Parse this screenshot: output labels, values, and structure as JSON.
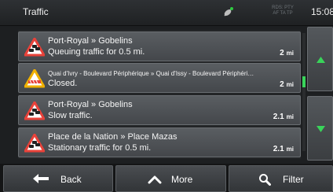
{
  "header": {
    "title": "Traffic",
    "gps_icon": "satellite-dish-icon",
    "rds_line1": "RDS: PTY",
    "rds_line2": "AF TA TP",
    "clock": "15:08"
  },
  "traffic_events": [
    {
      "route": "Port-Royal » Gobelins",
      "status": "Queuing traffic for 0.5 mi.",
      "distance": "2",
      "unit": "mi",
      "icon": "traffic-jam-warning-icon",
      "icon_color": "#e8423a"
    },
    {
      "route": "Quai d'Ivry - Boulevard Périphérique » Quai d'Issy - Boulevard Périphéri…",
      "status": "Closed.",
      "distance": "2",
      "unit": "mi",
      "icon": "road-works-warning-icon",
      "icon_color": "#f0b000"
    },
    {
      "route": "Port-Royal » Gobelins",
      "status": "Slow traffic.",
      "distance": "2.1",
      "unit": "mi",
      "icon": "traffic-jam-warning-icon",
      "icon_color": "#e8423a"
    },
    {
      "route": "Place de la Nation » Place Mazas",
      "status": "Stationary traffic for 0.5 mi.",
      "distance": "2.1",
      "unit": "mi",
      "icon": "traffic-jam-warning-icon",
      "icon_color": "#e8423a"
    }
  ],
  "side_buttons": {
    "up_icon": "scroll-up-arrow-icon",
    "down_icon": "scroll-down-arrow-icon",
    "accent": "#39d45a"
  },
  "footer": {
    "back_label": "Back",
    "more_label": "More",
    "filter_label": "Filter",
    "back_icon": "back-arrow-icon",
    "more_icon": "chevron-up-icon",
    "filter_icon": "search-icon"
  }
}
